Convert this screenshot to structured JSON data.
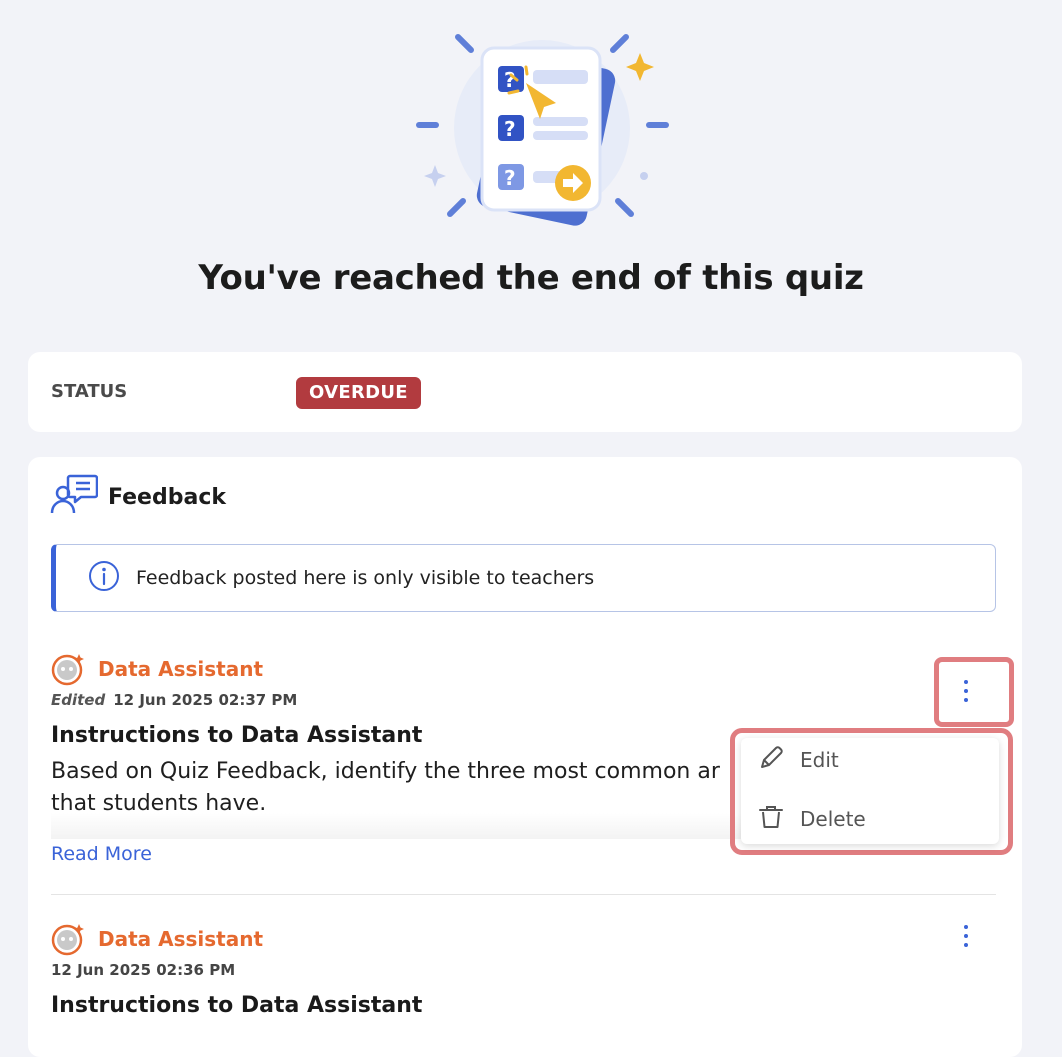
{
  "page": {
    "title": "You've reached the end of this quiz"
  },
  "status": {
    "label": "STATUS",
    "badge": "OVERDUE",
    "badge_color": "#b23b3f"
  },
  "feedback": {
    "title": "Feedback",
    "info_text": "Feedback posted here is only visible to teachers",
    "read_more": "Read More",
    "posts": [
      {
        "author": "Data Assistant",
        "edited_label": "Edited",
        "timestamp": "12 Jun 2025 02:37 PM",
        "heading": "Instructions to Data Assistant",
        "body": "Based on Quiz Feedback, identify the three most common ar",
        "body_line2": "that students have."
      },
      {
        "author": "Data Assistant",
        "timestamp": "12 Jun 2025 02:36 PM",
        "heading": "Instructions to Data Assistant"
      }
    ]
  },
  "context_menu": {
    "edit_label": "Edit",
    "delete_label": "Delete"
  },
  "colors": {
    "accent": "#3a63d8",
    "author": "#e5692f",
    "highlight": "#e07d80"
  },
  "icons": [
    "quiz-illustration",
    "feedback-icon",
    "info-icon",
    "avatar-icon",
    "kebab-icon",
    "pencil-icon",
    "trash-icon"
  ]
}
